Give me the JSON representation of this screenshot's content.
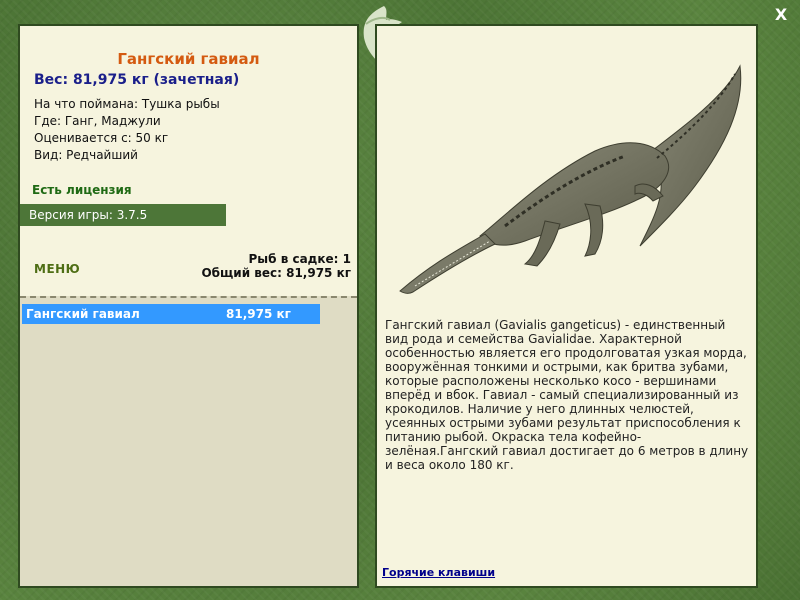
{
  "fish": {
    "name": "Гангский гавиал",
    "weight": "Вес: 81,975 кг (зачетная)",
    "caught_on": "На что поймана: Тушка рыбы",
    "where": "Где: Ганг, Маджули",
    "valued_from": "Оценивается с: 50 кг",
    "kind": "Вид: Редчайший"
  },
  "license": "Есть лицензия",
  "version": "Версия игры: 3.7.5",
  "menu_label": "МЕНЮ",
  "stats": {
    "in_cage": "Рыб в садке: 1",
    "total_weight": "Общий вес: 81,975 кг"
  },
  "list": [
    {
      "name": "Гангский гавиал",
      "weight": "81,975 кг"
    }
  ],
  "description": "Гангский гавиал (Gavialis gangeticus) - единственный вид рода и семейства Gavialidae. Характерной особенностью является его продолговатая узкая морда, вооружённая тонкими и острыми, как бритва зубами, которые расположены несколько косо - вершинами вперёд и вбок. Гавиал - самый специализированный из крокодилов. Наличие у него длинных челюстей, усеянных острыми зубами результат приспособления к питанию рыбой. Окраска тела кофейно-зелёная.Гангский гавиал достигает до 6 метров в длину и веса около 180 кг.",
  "hotkeys_link": "Горячие клавиши",
  "close_label": "X",
  "colors": {
    "frame": "#527a3a",
    "panel": "#f6f4de",
    "title": "#d45a10",
    "weight": "#1a1f8a",
    "selected_row": "#3399ff",
    "version_bar": "#4d7638"
  }
}
